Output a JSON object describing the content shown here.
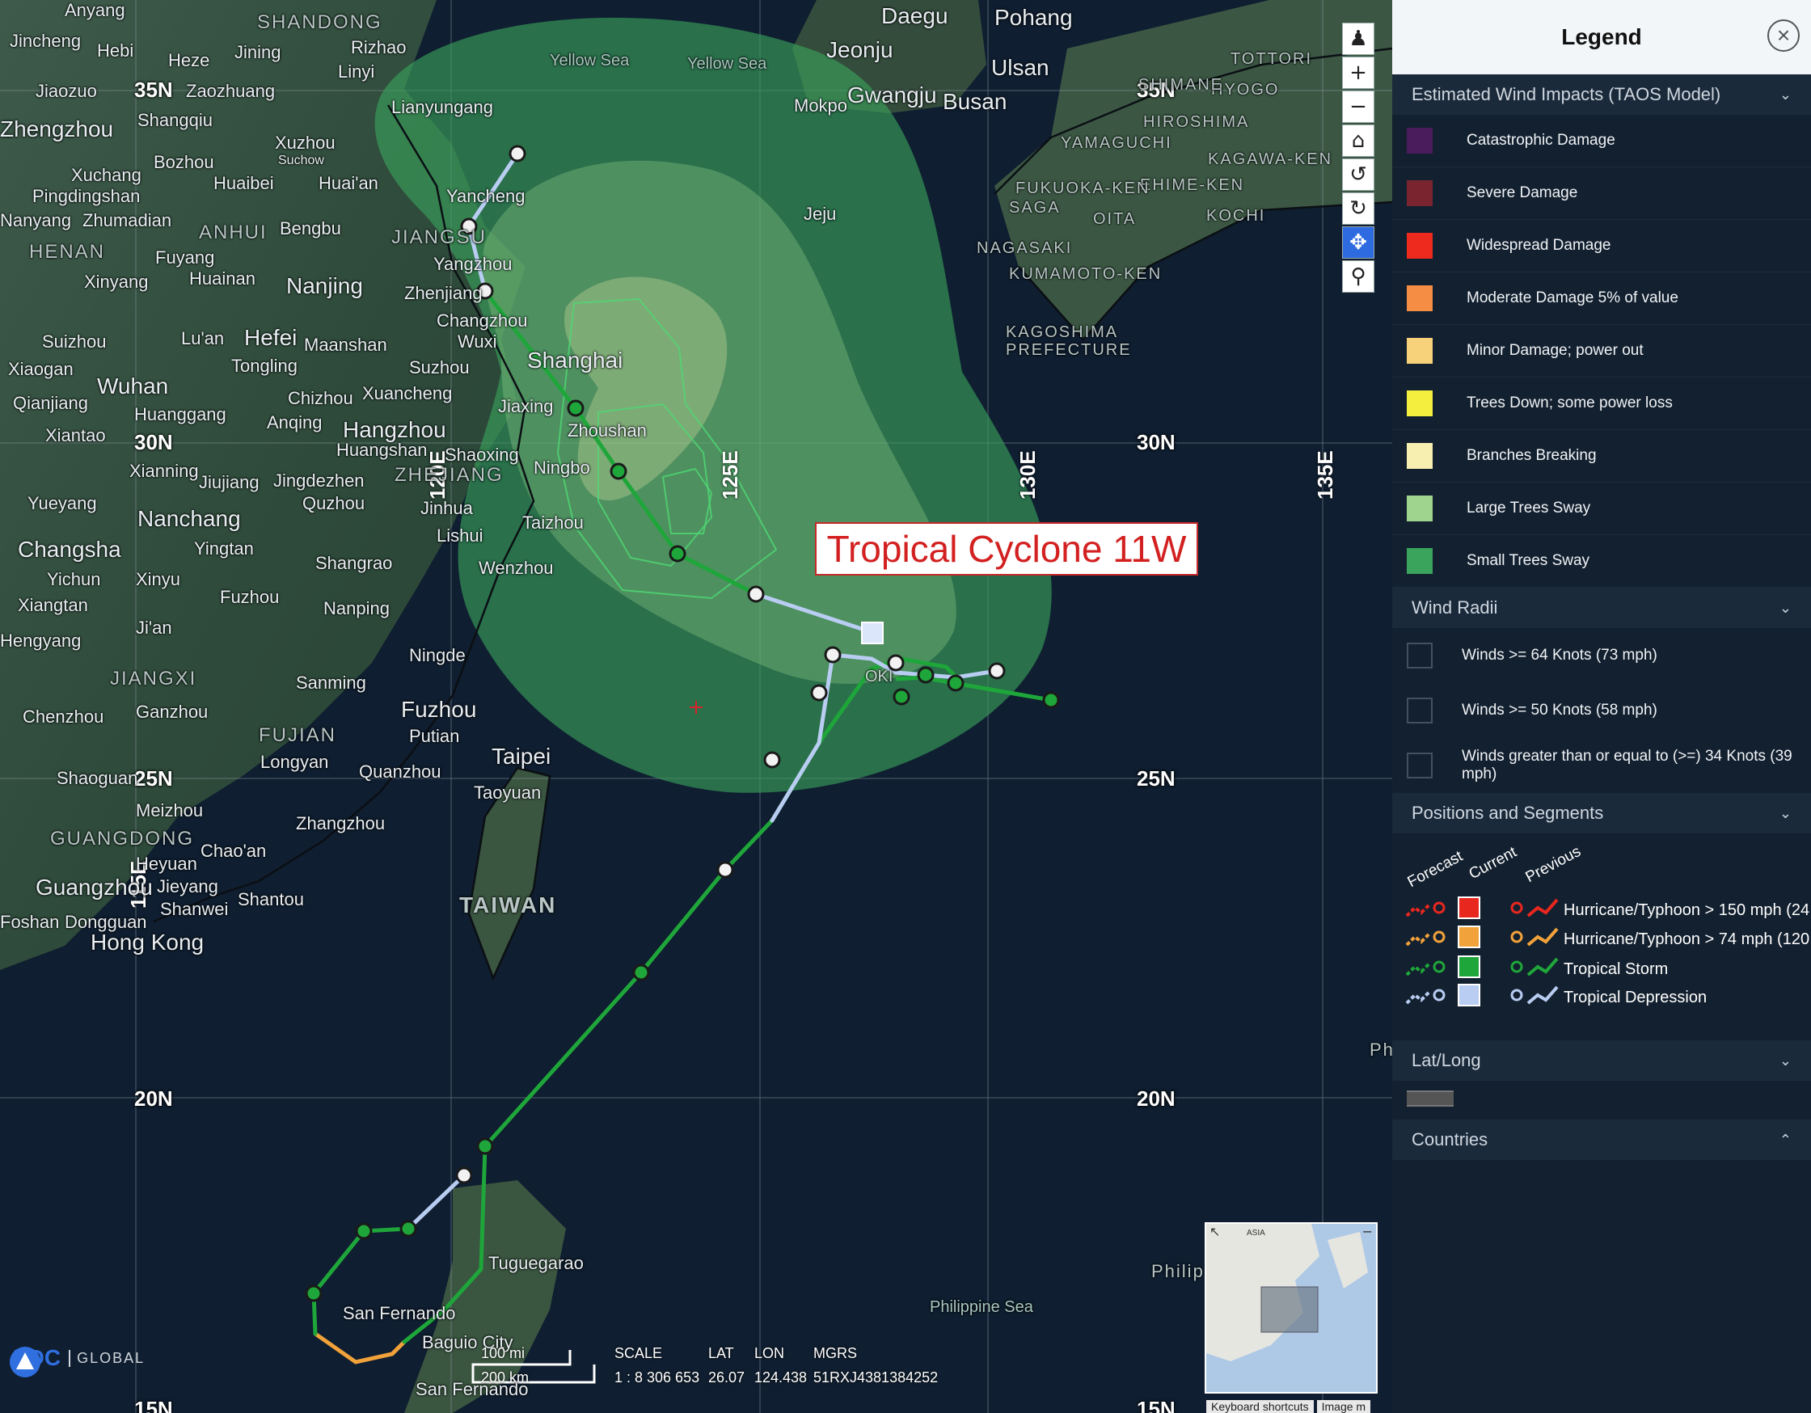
{
  "storm": {
    "name": "Tropical Cyclone 11W"
  },
  "map": {
    "lat_labels": [
      "35N",
      "30N",
      "25N",
      "20N",
      "15N",
      "35N",
      "30N",
      "25N",
      "20N",
      "15N"
    ],
    "lon_labels": [
      "115E",
      "120E",
      "125E",
      "130E",
      "135E"
    ],
    "places": [
      "Anyang",
      "Jincheng",
      "Hebi",
      "Heze",
      "Jining",
      "Rizhao",
      "Linyi",
      "Jiaozuo",
      "Zaozhuang",
      "Zhengzhou",
      "Shangqiu",
      "Xuzhou",
      "Suchow",
      "Bozhou",
      "Xuchang",
      "Pingdingshan",
      "Huaibei",
      "Huai'an",
      "Yancheng",
      "Nanyang",
      "Zhumadian",
      "Bengbu",
      "Fuyang",
      "Xinyang",
      "Huainan",
      "Nanjing",
      "Zhenjiang",
      "Yangzhou",
      "Changzhou",
      "Wuxi",
      "Suizhou",
      "Lu'an",
      "Hefei",
      "Maanshan",
      "Shanghai",
      "Suzhou",
      "Xiaogan",
      "Wuhan",
      "Tongling",
      "Chizhou",
      "Xuancheng",
      "Qianjiang",
      "Huanggang",
      "Anqing",
      "Hangzhou",
      "Jiaxing",
      "Zhoushan",
      "Xiantao",
      "Huangshan",
      "Shaoxing",
      "Ningbo",
      "Xianning",
      "Jiujiang",
      "Jingdezhen",
      "Yueyang",
      "Quzhou",
      "Jinhua",
      "Nanchang",
      "Lishui",
      "Taizhou",
      "Changsha",
      "Yingtan",
      "Shangrao",
      "Wenzhou",
      "Yichun",
      "Xinyu",
      "Fuzhou",
      "Xiangtan",
      "Ji'an",
      "Nanping",
      "Hengyang",
      "Ningde",
      "Sanming",
      "Chenzhou",
      "Ganzhou",
      "Fuzhou",
      "Putian",
      "Longyan",
      "Quanzhou",
      "Taipei",
      "Taoyuan",
      "Shaoguan",
      "Meizhou",
      "Zhangzhou",
      "Heyuan",
      "Chao'an",
      "Guangzhou",
      "Jieyang",
      "Shantou",
      "Shanwei",
      "Foshan",
      "Dongguan",
      "Hong Kong",
      "Daegu",
      "Pohang",
      "Jeonju",
      "Ulsan",
      "Mokpo",
      "Gwangju",
      "Busan",
      "Jeju",
      "Lianyungang",
      "Tuguegarao",
      "San Fernando",
      "Baguio City",
      "San Fernando"
    ],
    "regions": [
      "SHANDONG",
      "ANHUI",
      "JIANGSU",
      "HENAN",
      "ZHEJIANG",
      "JIANGXI",
      "FUJIAN",
      "GUANGDONG",
      "TAIWAN",
      "TOTTORI",
      "HYOGO",
      "SHIMANE",
      "HIROSHIMA",
      "YAMAGUCHI",
      "KAGAWA-KEN",
      "EHIME-KEN",
      "KOCHI",
      "FUKUOKA-KEN",
      "SAGA",
      "OITA",
      "NAGASAKI",
      "KUMAMOTO-KEN",
      "KAGOSHIMA PREFECTURE",
      "Philip",
      "Philip"
    ],
    "seas": [
      "Yellow Sea",
      "Yellow Sea",
      "Philippine Sea"
    ],
    "okinawa": "OKI"
  },
  "scale_bar": {
    "top": "100 mi",
    "bottom": "200 km"
  },
  "readout": {
    "scale_label": "SCALE",
    "scale_value": "1 : 8 306 653",
    "lat_label": "LAT",
    "lat_value": "26.07",
    "lon_label": "LON",
    "lon_value": "124.438",
    "mgrs_label": "MGRS",
    "mgrs_value": "51RXJ4381384252"
  },
  "logo": {
    "brand": "PDC",
    "suffix": "GLOBAL"
  },
  "inset_map": {
    "label": "ASIA"
  },
  "footer_links": [
    "Keyboard shortcuts",
    "Image m"
  ],
  "legend": {
    "title": "Legend",
    "sections": {
      "wind_impacts": "Estimated Wind Impacts (TAOS Model)",
      "wind_radii": "Wind Radii",
      "positions": "Positions and Segments",
      "latlong": "Lat/Long",
      "countries": "Countries"
    },
    "wind_impacts": [
      {
        "label": "Catastrophic Damage",
        "color": "#4a1c5c"
      },
      {
        "label": "Severe Damage",
        "color": "#7a2430"
      },
      {
        "label": "Widespread Damage",
        "color": "#ee2a1e"
      },
      {
        "label": "Moderate Damage 5% of value",
        "color": "#f58d45"
      },
      {
        "label": "Minor Damage; power out",
        "color": "#f7d27a"
      },
      {
        "label": "Trees Down; some power loss",
        "color": "#f4ef3e"
      },
      {
        "label": "Branches Breaking",
        "color": "#f7efb0"
      },
      {
        "label": "Large Trees Sway",
        "color": "#9fd48f"
      },
      {
        "label": "Small Trees Sway",
        "color": "#3aa35c"
      }
    ],
    "wind_radii": [
      {
        "label": "Winds >= 64 Knots (73 mph)"
      },
      {
        "label": "Winds >= 50 Knots (58 mph)"
      },
      {
        "label": "Winds greater than or equal to (>=) 34 Knots (39 mph)"
      }
    ],
    "positions_headers": [
      "Forecast",
      "Current",
      "Previous"
    ],
    "positions_types": [
      {
        "label": "Hurricane/Typhoon > 150 mph (24",
        "color": "#e8271f"
      },
      {
        "label": "Hurricane/Typhoon > 74 mph (120",
        "color": "#f2a23a"
      },
      {
        "label": "Tropical Storm",
        "color": "#1fa63a"
      },
      {
        "label": "Tropical Depression",
        "color": "#b9cdf2"
      }
    ],
    "icons": {
      "close": "close-icon",
      "expand": "chevron-down-icon",
      "collapse": "chevron-up-icon"
    }
  },
  "toolbar": {
    "icons": [
      "street-view-icon",
      "zoom-in-icon",
      "zoom-out-icon",
      "home-icon",
      "rotate-left-icon",
      "rotate-right-icon",
      "pan-icon",
      "zoom-box-icon"
    ]
  }
}
